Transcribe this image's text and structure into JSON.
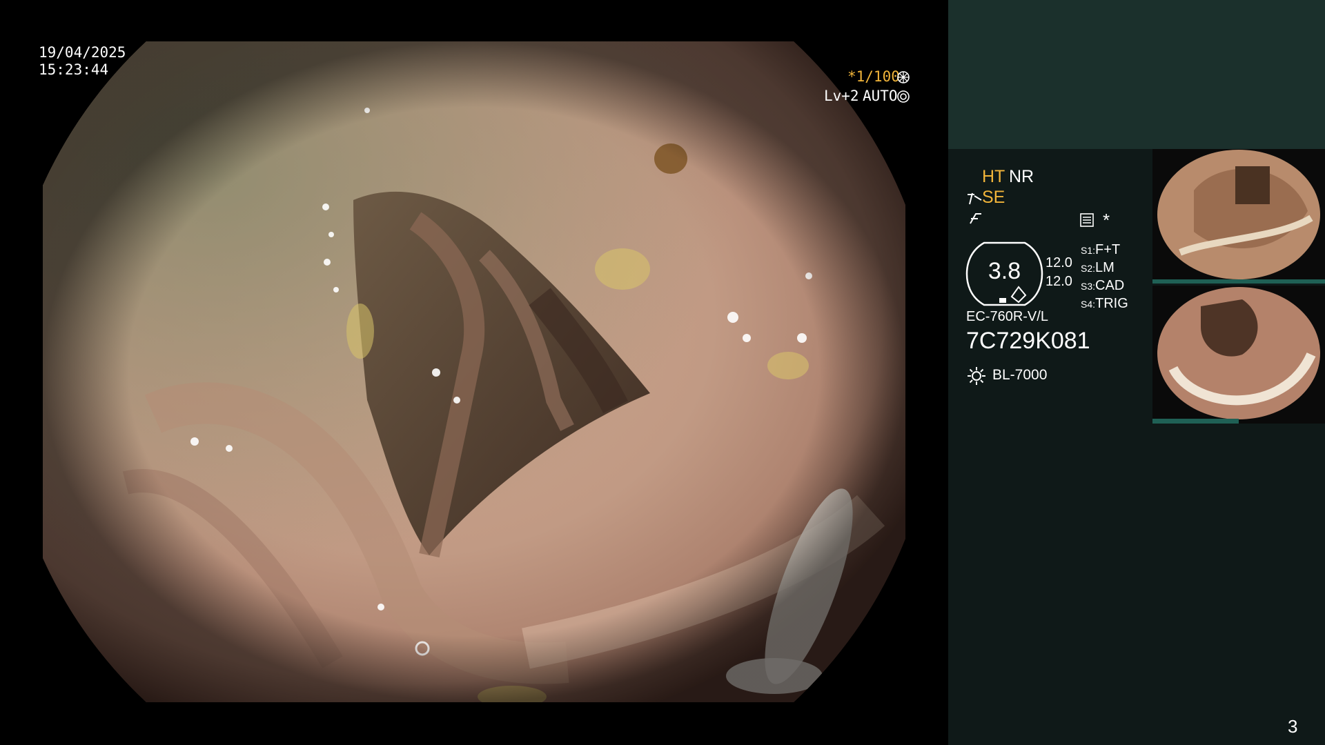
{
  "overlay": {
    "date": "19/04/2025",
    "time": "15:23:44",
    "shutter": "*1/100",
    "level": "Lv+2",
    "mode": "AUTO"
  },
  "panel": {
    "ht": "HT",
    "nr": "NR",
    "se": "SE",
    "zoom_value": "3.8",
    "val1": "12.0",
    "val2": "12.0",
    "star": "*",
    "switches": [
      {
        "key": "S1:",
        "value": "F+T"
      },
      {
        "key": "S2:",
        "value": "LM"
      },
      {
        "key": "S3:",
        "value": "CAD"
      },
      {
        "key": "S4:",
        "value": "TRIG"
      }
    ],
    "scope_model": "EC-760R-V/L",
    "serial": "7C729K081",
    "light_source": "BL-7000",
    "page_number": "3"
  },
  "colors": {
    "amber": "#f2b53a",
    "panel_top": "#1b302c",
    "panel_bg": "#0f1918",
    "mucosa": "#c9a48c"
  },
  "icons": [
    "shutter-wheel-icon",
    "auto-iris-icon",
    "structure-enhance-icon",
    "freeze-icon",
    "settings-list-icon",
    "lamp-icon"
  ]
}
